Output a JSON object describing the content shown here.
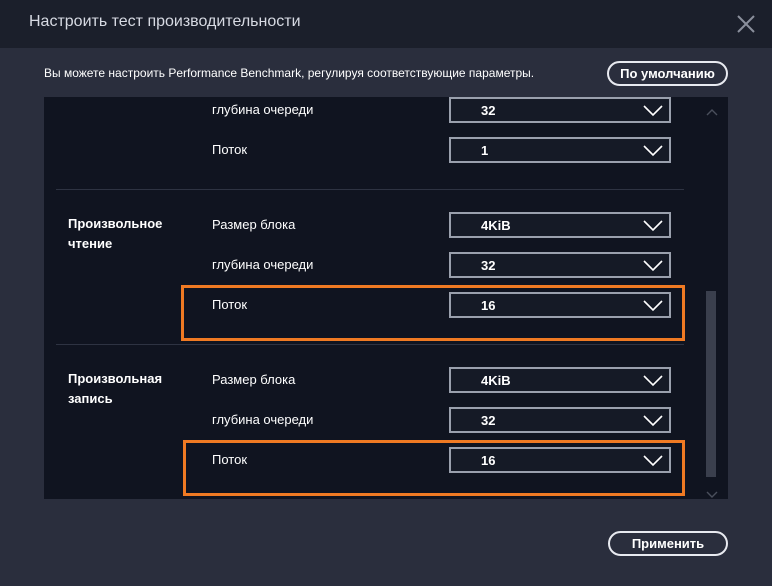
{
  "window": {
    "title": "Настроить тест производительности"
  },
  "description": "Вы можете настроить Performance Benchmark, регулируя соответствующие параметры.",
  "buttons": {
    "default": "По умолчанию",
    "apply": "Применить"
  },
  "icons": {
    "close": "close-icon",
    "dropdown": "chevron-down-icon",
    "scroll_up": "chevron-up-icon",
    "scroll_down": "chevron-down-icon"
  },
  "colors": {
    "highlight": "#f07a23",
    "background": "#2a2e3d",
    "panel": "#101420"
  },
  "groups": [
    {
      "name": "",
      "rows": [
        {
          "label": "глубина очереди",
          "value": "32"
        },
        {
          "label": "Поток",
          "value": "1"
        }
      ]
    },
    {
      "name": "Произвольное\nчтение",
      "rows": [
        {
          "label": "Размер блока",
          "value": "4KiB"
        },
        {
          "label": "глубина очереди",
          "value": "32"
        },
        {
          "label": "Поток",
          "value": "16"
        }
      ]
    },
    {
      "name": "Произвольная\nзапись",
      "rows": [
        {
          "label": "Размер блока",
          "value": "4KiB"
        },
        {
          "label": "глубина очереди",
          "value": "32"
        },
        {
          "label": "Поток",
          "value": "16"
        }
      ]
    }
  ]
}
